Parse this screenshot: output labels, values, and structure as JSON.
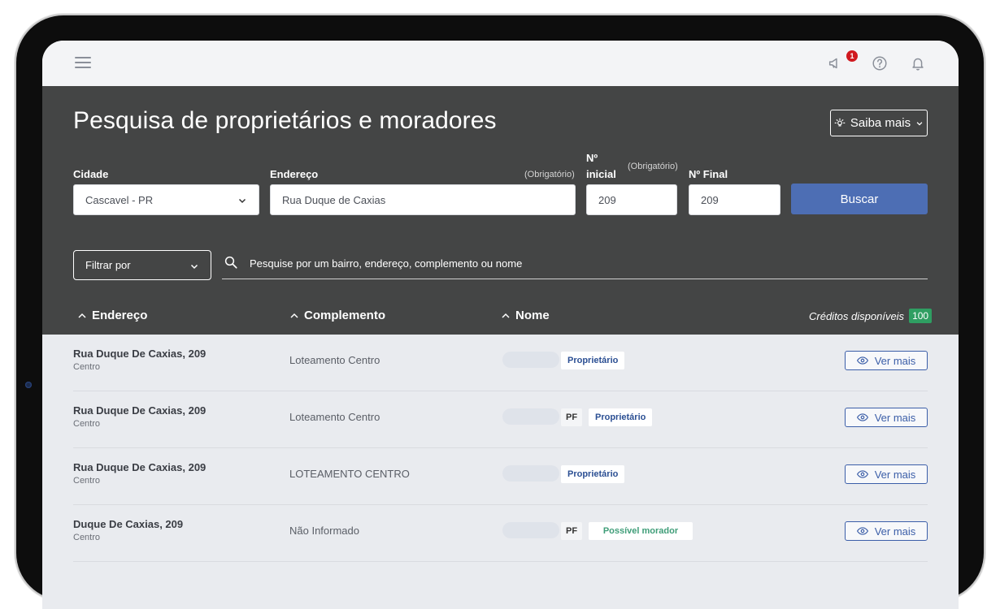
{
  "topbar": {
    "notification_count": "1"
  },
  "page": {
    "title": "Pesquisa de proprietários e moradores",
    "saiba_mais_label": "Saiba mais"
  },
  "form": {
    "cidade_label": "Cidade",
    "cidade_value": "Cascavel - PR",
    "endereco_label": "Endereço",
    "endereco_required": "(Obrigatório)",
    "endereco_value": "Rua Duque de Caxias",
    "num_inicial_label_line1": "Nº",
    "num_inicial_label_line2": "inicial",
    "num_inicial_required": "(Obrigatório)",
    "num_inicial_value": "209",
    "num_final_label": "Nº Final",
    "num_final_value": "209",
    "buscar_label": "Buscar"
  },
  "filter": {
    "filtrar_label": "Filtrar por",
    "search_placeholder": "Pesquise por um bairro, endereço, complemento ou nome"
  },
  "columns": {
    "endereco": "Endereço",
    "complemento": "Complemento",
    "nome": "Nome",
    "creditos_label": "Créditos disponíveis",
    "creditos_value": "100"
  },
  "rows": [
    {
      "address": "Rua Duque De Caxias, 209",
      "bairro": "Centro",
      "complemento": "Loteamento Centro",
      "pf": "",
      "tag": "Proprietário",
      "ver_mais": "Ver mais"
    },
    {
      "address": "Rua Duque De Caxias, 209",
      "bairro": "Centro",
      "complemento": "Loteamento Centro",
      "pf": "PF",
      "tag": "Proprietário",
      "ver_mais": "Ver mais"
    },
    {
      "address": "Rua Duque De Caxias, 209",
      "bairro": "Centro",
      "complemento": "LOTEAMENTO CENTRO",
      "pf": "",
      "tag": "Proprietário",
      "ver_mais": "Ver mais"
    },
    {
      "address": "Duque De Caxias, 209",
      "bairro": "Centro",
      "complemento": "Não Informado",
      "pf": "PF",
      "tag": "Possível morador",
      "ver_mais": "Ver mais"
    }
  ],
  "colors": {
    "hero_bg": "#444545",
    "primary": "#4d6eb4",
    "credit_green": "#2f9e62",
    "tag_blue": "#2b4f93",
    "tag_green": "#3f9d78",
    "badge_red": "#d0191f"
  }
}
